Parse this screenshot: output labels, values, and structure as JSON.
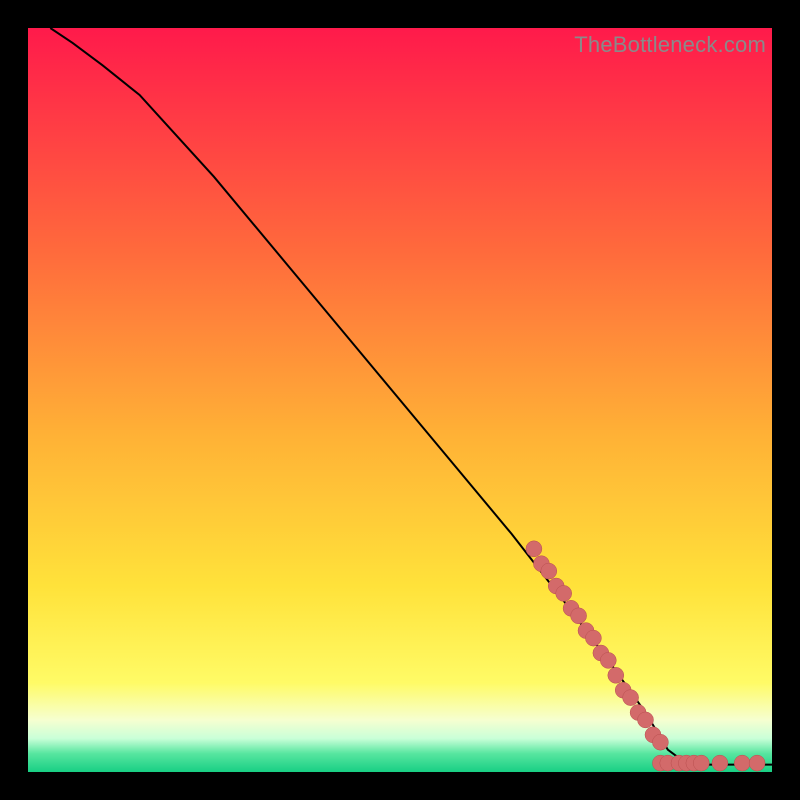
{
  "watermark_text": "TheBottleneck.com",
  "colors": {
    "frame": "#000000",
    "watermark": "#8a8a8a",
    "curve_stroke": "#000000",
    "point_fill": "#d36a6a",
    "point_stroke": "#b94f4f",
    "gradient_stops": [
      {
        "offset": 0.0,
        "color": "#ff1a4b"
      },
      {
        "offset": 0.3,
        "color": "#ff6a3c"
      },
      {
        "offset": 0.55,
        "color": "#ffb236"
      },
      {
        "offset": 0.75,
        "color": "#ffe23a"
      },
      {
        "offset": 0.88,
        "color": "#fffb66"
      },
      {
        "offset": 0.93,
        "color": "#f6ffd0"
      },
      {
        "offset": 0.955,
        "color": "#c9ffd8"
      },
      {
        "offset": 0.975,
        "color": "#58e6a0"
      },
      {
        "offset": 1.0,
        "color": "#18cf84"
      }
    ]
  },
  "chart_data": {
    "type": "line",
    "title": "",
    "xlabel": "",
    "ylabel": "",
    "xlim": [
      0,
      100
    ],
    "ylim": [
      0,
      100
    ],
    "curve": [
      {
        "x": 3,
        "y": 100
      },
      {
        "x": 6,
        "y": 98
      },
      {
        "x": 10,
        "y": 95
      },
      {
        "x": 15,
        "y": 91
      },
      {
        "x": 25,
        "y": 80
      },
      {
        "x": 35,
        "y": 68
      },
      {
        "x": 45,
        "y": 56
      },
      {
        "x": 55,
        "y": 44
      },
      {
        "x": 65,
        "y": 32
      },
      {
        "x": 72,
        "y": 23
      },
      {
        "x": 78,
        "y": 15
      },
      {
        "x": 83,
        "y": 8
      },
      {
        "x": 86,
        "y": 3
      },
      {
        "x": 88,
        "y": 1.5
      },
      {
        "x": 90,
        "y": 1
      },
      {
        "x": 100,
        "y": 1
      }
    ],
    "scatter_cluster": [
      {
        "x": 68,
        "y": 30
      },
      {
        "x": 69,
        "y": 28
      },
      {
        "x": 70,
        "y": 27
      },
      {
        "x": 71,
        "y": 25
      },
      {
        "x": 72,
        "y": 24
      },
      {
        "x": 73,
        "y": 22
      },
      {
        "x": 74,
        "y": 21
      },
      {
        "x": 75,
        "y": 19
      },
      {
        "x": 76,
        "y": 18
      },
      {
        "x": 77,
        "y": 16
      },
      {
        "x": 78,
        "y": 15
      },
      {
        "x": 79,
        "y": 13
      },
      {
        "x": 80,
        "y": 11
      },
      {
        "x": 81,
        "y": 10
      },
      {
        "x": 82,
        "y": 8
      },
      {
        "x": 83,
        "y": 7
      },
      {
        "x": 84,
        "y": 5
      },
      {
        "x": 85,
        "y": 4
      }
    ],
    "scatter_flat": [
      {
        "x": 85,
        "y": 1.2
      },
      {
        "x": 86,
        "y": 1.2
      },
      {
        "x": 87.5,
        "y": 1.2
      },
      {
        "x": 88.5,
        "y": 1.2
      },
      {
        "x": 89.5,
        "y": 1.2
      },
      {
        "x": 90.5,
        "y": 1.2
      },
      {
        "x": 93,
        "y": 1.2
      },
      {
        "x": 96,
        "y": 1.2
      },
      {
        "x": 98,
        "y": 1.2
      }
    ],
    "point_radius": 8
  }
}
